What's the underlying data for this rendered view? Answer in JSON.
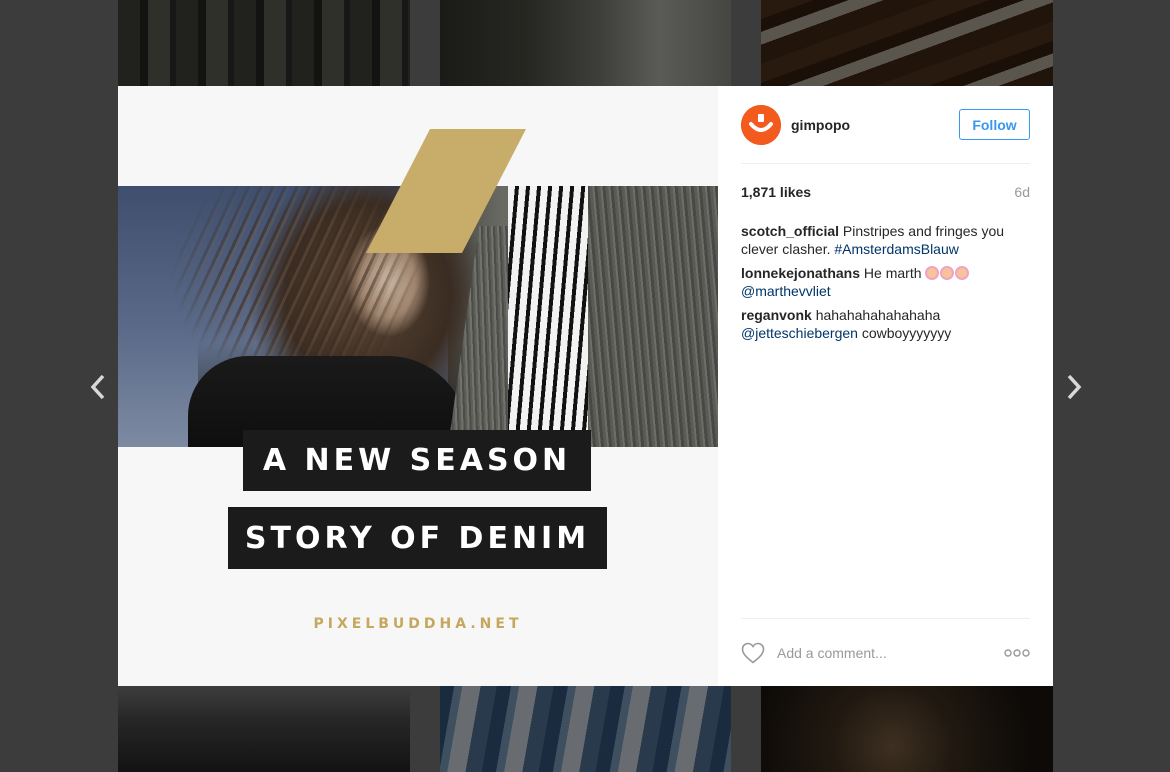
{
  "post": {
    "headline_1": "A NEW SEASON",
    "headline_2": "STORY OF DENIM",
    "footer_url": "PIXELBUDDHA.NET",
    "accent_color": "#c8ad6a"
  },
  "header": {
    "username": "gimpopo",
    "follow_label": "Follow",
    "avatar_color": "#f35a1e"
  },
  "stats": {
    "likes": "1,871 likes",
    "time_ago": "6d"
  },
  "comments": [
    {
      "user": "scotch_official",
      "text": " Pinstripes and fringes you clever clasher. ",
      "hashtag": "#AmsterdamsBlauw"
    },
    {
      "user": "lonnekejonathans",
      "text": " He marth ",
      "mention": "@marthevvliet"
    },
    {
      "user": "reganvonk",
      "text": " hahahahahahahaha ",
      "mention": "@jetteschiebergen",
      "tail": " cowboyyyyyyy"
    }
  ],
  "comment_bar": {
    "placeholder": "Add a comment..."
  },
  "icons": {
    "prev": "chevron-left-icon",
    "next": "chevron-right-icon",
    "like": "heart-icon",
    "more": "more-options-icon",
    "emoji": "blonde-woman-emoji"
  }
}
